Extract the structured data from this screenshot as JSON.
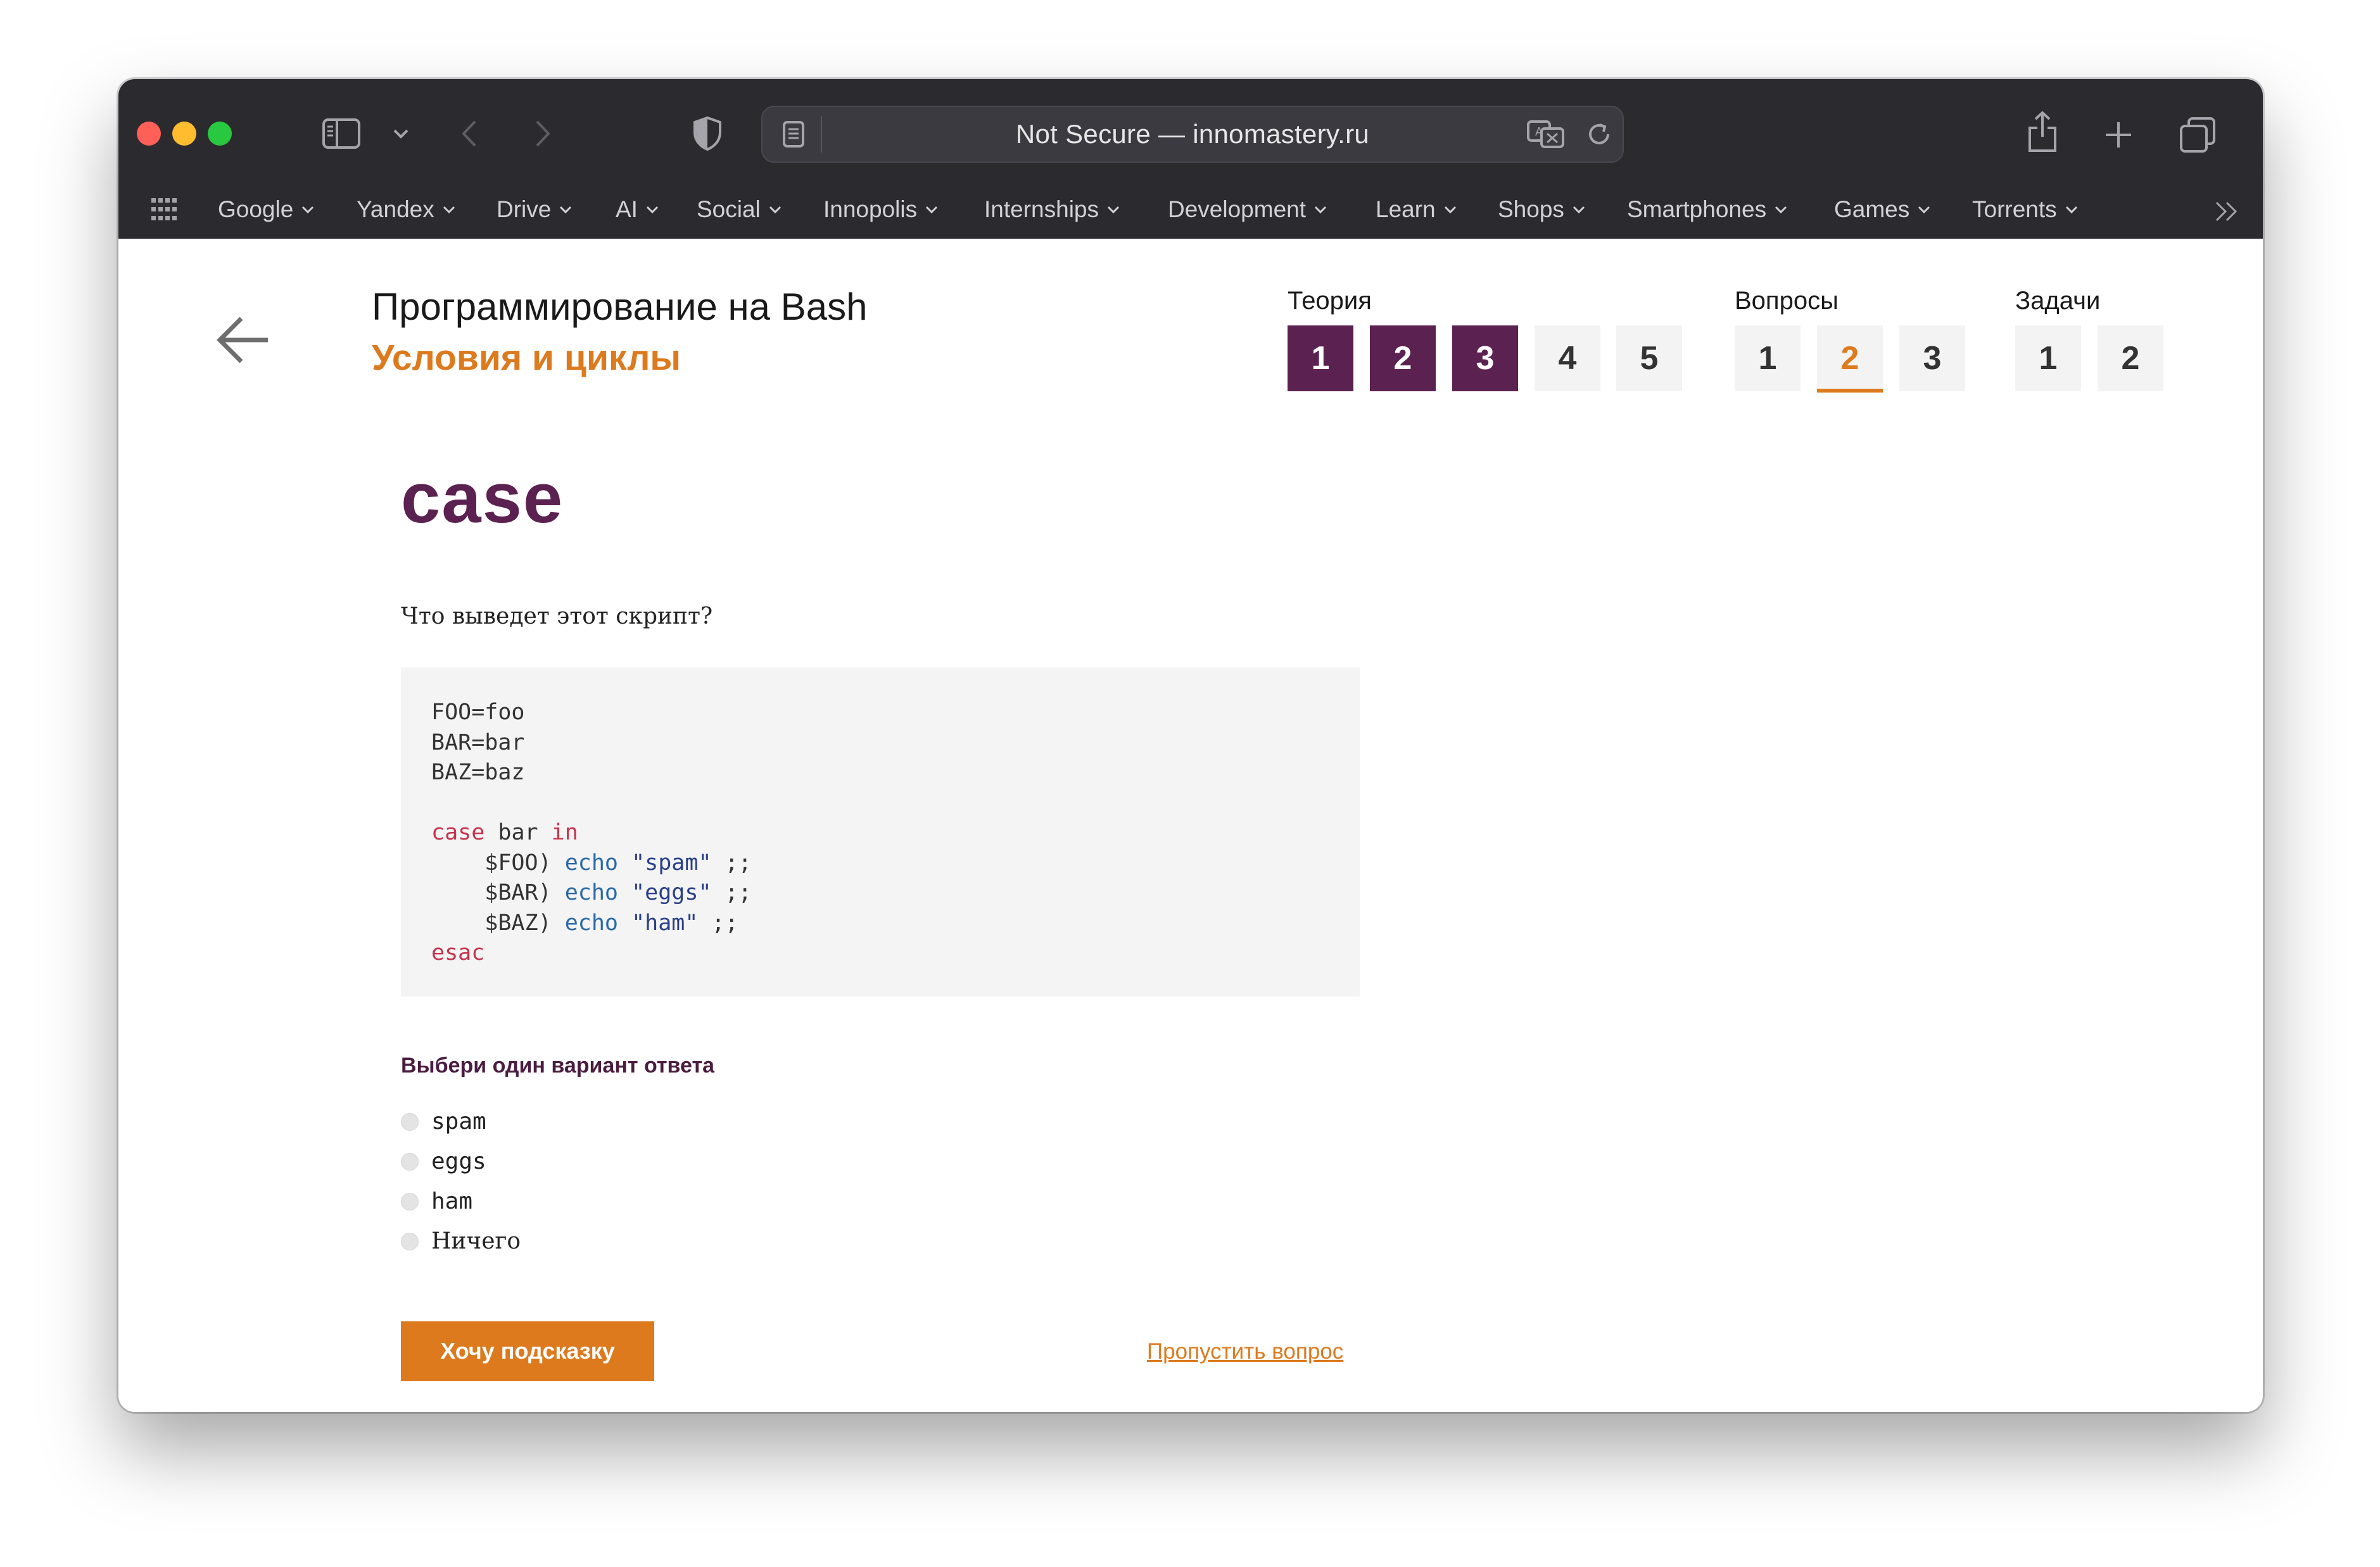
{
  "browser": {
    "address": "Not Secure — innomastery.ru",
    "bookmarks": [
      "Google",
      "Yandex",
      "Drive",
      "AI",
      "Social",
      "Innopolis",
      "Internships",
      "Development",
      "Learn",
      "Shops",
      "Smartphones",
      "Games",
      "Torrents"
    ]
  },
  "course": {
    "title": "Программирование на Bash",
    "lesson": "Условия и циклы"
  },
  "nav": {
    "theory": {
      "label": "Теория",
      "items": [
        "1",
        "2",
        "3",
        "4",
        "5"
      ],
      "completed": 3
    },
    "questions": {
      "label": "Вопросы",
      "items": [
        "1",
        "2",
        "3"
      ],
      "active": "2"
    },
    "tasks": {
      "label": "Задачи",
      "items": [
        "1",
        "2"
      ]
    }
  },
  "main": {
    "heading": "case",
    "question": "Что выведет этот скрипт?",
    "code": {
      "l1": "FOO=foo",
      "l2": "BAR=bar",
      "l3": "BAZ=baz",
      "case_kw": "case",
      "case_var": " bar ",
      "in_kw": "in",
      "arm1_pat": "    $FOO) ",
      "arm2_pat": "    $BAR) ",
      "arm3_pat": "    $BAZ) ",
      "echo_kw": "echo",
      "arm1_str": "\"spam\"",
      "arm2_str": "\"eggs\"",
      "arm3_str": "\"ham\"",
      "terminator": " ;;",
      "esac_kw": "esac"
    },
    "answer_label": "Выбери один вариант ответа",
    "options": [
      "spam",
      "eggs",
      "ham",
      "Ничего"
    ],
    "hint_button": "Хочу подсказку",
    "skip_link": "Пропустить вопрос"
  },
  "colors": {
    "accent": "#dd7a1e",
    "brand": "#5b2150",
    "toolbar": "#2b2a2f"
  }
}
